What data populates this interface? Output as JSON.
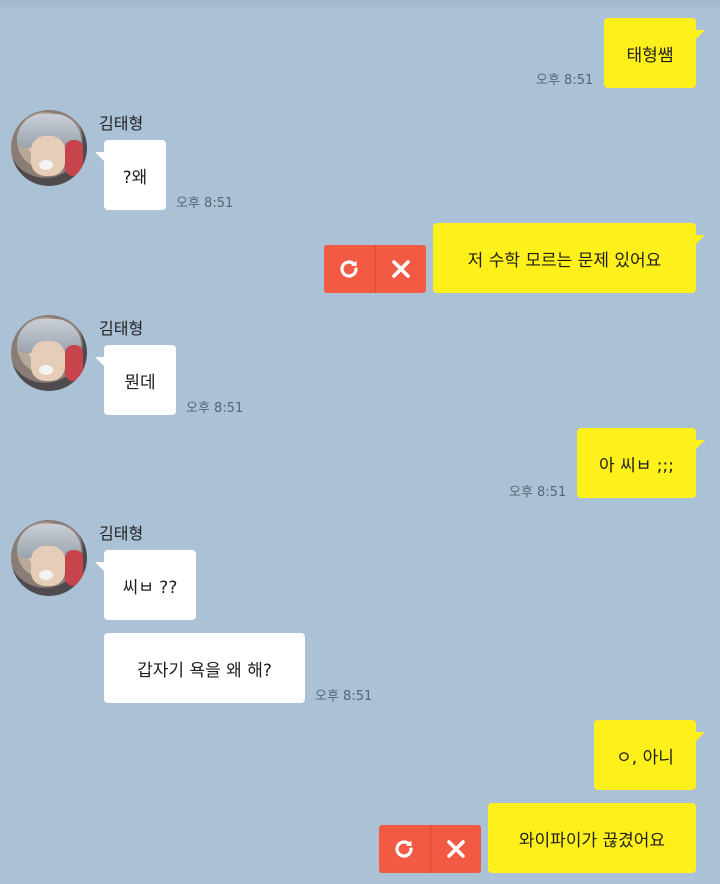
{
  "chat": {
    "sender_name": "김태형",
    "messages": [
      {
        "text": "태형쌤",
        "time": "오후 8:51"
      },
      {
        "text": "?왜",
        "time": "오후 8:51"
      },
      {
        "text": "저 수학 모르는 문제 있어요"
      },
      {
        "text": "뭔데",
        "time": "오후 8:51"
      },
      {
        "text": "아 씨ㅂ ;;;",
        "time": "오후 8:51"
      },
      {
        "text": "씨ㅂ ??"
      },
      {
        "text": "갑자기 욕을 왜 해?",
        "time": "오후 8:51"
      },
      {
        "text": "ㅇ, 아니"
      },
      {
        "text": "와이파이가 끊겼어요"
      }
    ]
  },
  "icons": {
    "resend": "resend-icon",
    "delete": "close-icon",
    "avatar": "avatar"
  },
  "colors": {
    "background": "#abc1d6",
    "my_bubble": "#fef01b",
    "their_bubble": "#ffffff",
    "failed_action": "#f25a43"
  }
}
